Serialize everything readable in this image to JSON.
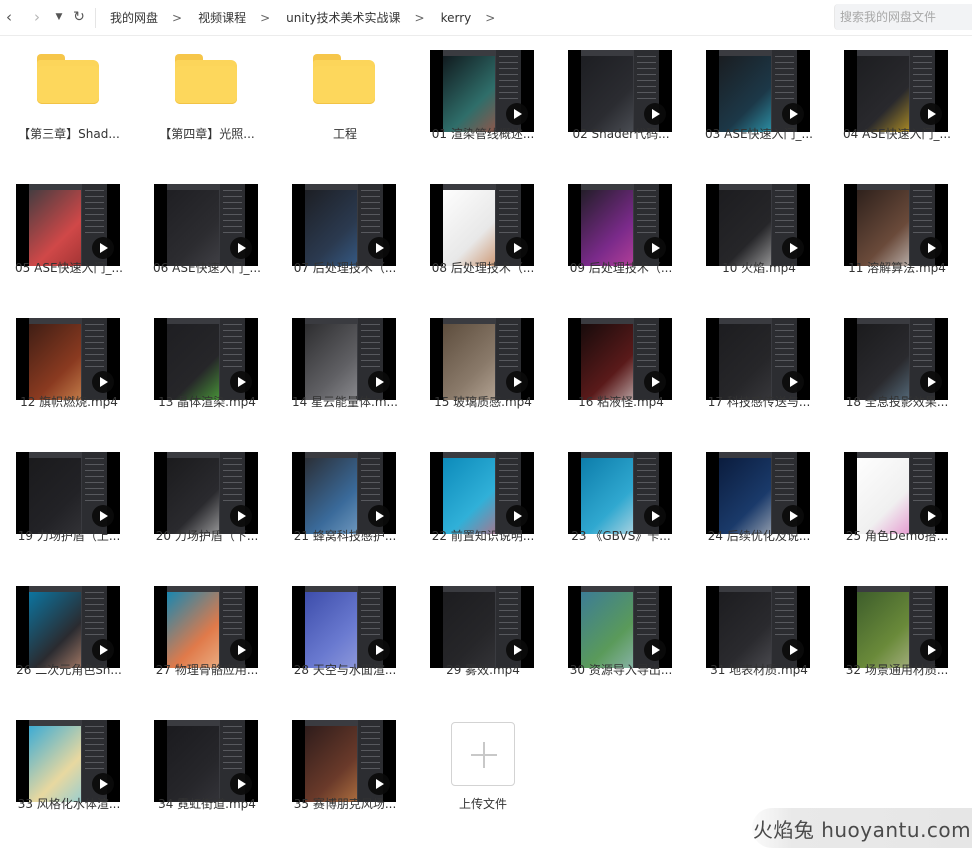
{
  "breadcrumb": [
    "我的网盘",
    "视频课程",
    "unity技术美术实战课",
    "kerry"
  ],
  "search": {
    "placeholder": "搜索我的网盘文件"
  },
  "folders": [
    {
      "name": "【第三章】Shad..."
    },
    {
      "name": "【第四章】光照..."
    },
    {
      "name": "工程"
    }
  ],
  "videos": [
    {
      "name": "01 渲染管线概述...",
      "colors": [
        "#0f1419",
        "#2f6e6a",
        "#c04a3a"
      ]
    },
    {
      "name": "02 Shader代码...",
      "colors": [
        "#1c1d21",
        "#2b2c31",
        "#5b5f66"
      ]
    },
    {
      "name": "03 ASE快速入门_...",
      "colors": [
        "#1a1b1e",
        "#1c3848",
        "#35c0d8"
      ]
    },
    {
      "name": "04 ASE快速入门_...",
      "colors": [
        "#1c1d20",
        "#29292d",
        "#f0c020"
      ]
    },
    {
      "name": "05 ASE快速入门_...",
      "colors": [
        "#3b3c40",
        "#d04848",
        "#8a2a2a"
      ]
    },
    {
      "name": "06 ASE快速入门_...",
      "colors": [
        "#1e1e22",
        "#2c2c30",
        "#4a4a50"
      ]
    },
    {
      "name": "07 后处理技术（...",
      "colors": [
        "#1c1d21",
        "#2b3a50",
        "#3a6aa0"
      ]
    },
    {
      "name": "08 后处理技术（...",
      "colors": [
        "#ffffff",
        "#e8e8e8",
        "#c0703a"
      ]
    },
    {
      "name": "09 后处理技术（...",
      "colors": [
        "#1d1d22",
        "#7a2a8a",
        "#d04aa0"
      ]
    },
    {
      "name": "10 火焰.mp4",
      "colors": [
        "#1c1c1f",
        "#262629",
        "#d0d0d0"
      ]
    },
    {
      "name": "11 溶解算法.mp4",
      "colors": [
        "#2a1e1a",
        "#6a4a3a",
        "#e0e0e0"
      ]
    },
    {
      "name": "12 旗帜燃烧.mp4",
      "colors": [
        "#3a1c14",
        "#8a3a20",
        "#e0a060"
      ]
    },
    {
      "name": "13 晶体渲染.mp4",
      "colors": [
        "#1e1e22",
        "#262629",
        "#5ad040"
      ]
    },
    {
      "name": "14 星云能量体.m...",
      "colors": [
        "#2a2a2c",
        "#606064",
        "#a0a0a4"
      ]
    },
    {
      "name": "15 玻璃质感.mp4",
      "colors": [
        "#5a4a3a",
        "#8a7a6a",
        "#c8b8a8"
      ]
    },
    {
      "name": "16 粘液怪.mp4",
      "colors": [
        "#120a0a",
        "#5a1a1a",
        "#e8e8e8"
      ]
    },
    {
      "name": "17 科技感传送与...",
      "colors": [
        "#1c1c1f",
        "#262629",
        "#404044"
      ]
    },
    {
      "name": "18 全息投影效果...",
      "colors": [
        "#1a1a1c",
        "#2a2a2e",
        "#6a8aa0"
      ]
    },
    {
      "name": "19 力场护盾（上...",
      "colors": [
        "#1a1a1c",
        "#222226",
        "#3a3a3e"
      ]
    },
    {
      "name": "20 力场护盾（下...",
      "colors": [
        "#1a1a1c",
        "#2a2a2e",
        "#d0d0d0"
      ]
    },
    {
      "name": "21 蜂窝科技感护...",
      "colors": [
        "#2a2b30",
        "#3a6a9a",
        "#8ab0d0"
      ]
    },
    {
      "name": "22 前置知识说明...",
      "colors": [
        "#0a88b8",
        "#30b0d8",
        "#e05a6a"
      ]
    },
    {
      "name": "23 《GBVS》卡...",
      "colors": [
        "#0a7aa8",
        "#30a8d0",
        "#e8e8e8"
      ]
    },
    {
      "name": "24 后续优化及说...",
      "colors": [
        "#0a1a3a",
        "#1a3a6a",
        "#d0d0d0"
      ]
    },
    {
      "name": "25 角色Demo搭...",
      "colors": [
        "#ffffff",
        "#f0f0f0",
        "#e070c0"
      ]
    },
    {
      "name": "26 二次元角色Sh...",
      "colors": [
        "#0a7aa8",
        "#2a2b30",
        "#e0a080"
      ]
    },
    {
      "name": "27 物理骨骼应用...",
      "colors": [
        "#0a88b8",
        "#e07a4a",
        "#f0c8a0"
      ]
    },
    {
      "name": "28 天空与水面渲...",
      "colors": [
        "#3a4aa8",
        "#6a7ad0",
        "#a0a8e0"
      ]
    },
    {
      "name": "29 雾效.mp4",
      "colors": [
        "#1c1c1f",
        "#262629",
        "#3a3a3e"
      ]
    },
    {
      "name": "30 资源导入导出...",
      "colors": [
        "#3a7a9a",
        "#5a9a5a",
        "#a0c0d0"
      ]
    },
    {
      "name": "31 地表材质.mp4",
      "colors": [
        "#1c1c1f",
        "#2a2a2e",
        "#5a5a60"
      ]
    },
    {
      "name": "32 场景通用材质...",
      "colors": [
        "#3a5a2a",
        "#6a8a3a",
        "#c0c0a0"
      ]
    },
    {
      "name": "33 风格化水体渲...",
      "colors": [
        "#30a8d8",
        "#e8d8a0",
        "#70c8e8"
      ]
    },
    {
      "name": "34 霓虹街道.mp4",
      "colors": [
        "#1a1a1e",
        "#26262a",
        "#3a3a40"
      ]
    },
    {
      "name": "35 赛博朋克风场...",
      "colors": [
        "#2a1a1a",
        "#6a3a2a",
        "#d08a4a"
      ]
    }
  ],
  "upload": {
    "label": "上传文件"
  },
  "watermark": "火焰兔 huoyantu.com"
}
